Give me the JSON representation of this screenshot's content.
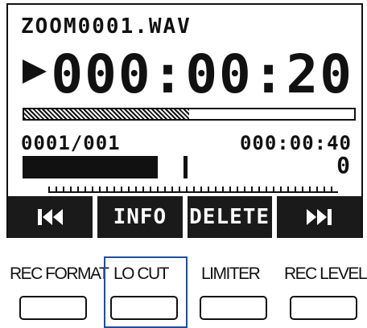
{
  "display": {
    "file_name": "ZOOM0001.WAV",
    "elapsed_time": "000:00:20",
    "track_count": "0001/001",
    "total_time": "000:00:40",
    "clip_indicator": "0",
    "progress_fraction": 0.5
  },
  "softkeys": {
    "prev": "prev-track-icon",
    "info": "INFO",
    "delete": "DELETE",
    "next": "next-track-icon"
  },
  "hardware_buttons": {
    "rec_format": "REC FORMAT",
    "lo_cut": "LO CUT",
    "limiter": "LIMITER",
    "rec_level": "REC LEVEL"
  },
  "colors": {
    "highlight": "#1f4ea0",
    "lcd_ink": "#111111"
  }
}
